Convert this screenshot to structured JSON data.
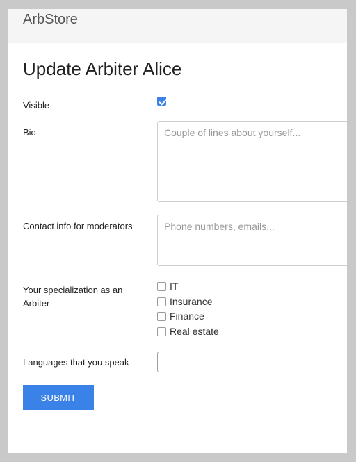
{
  "navbar": {
    "brand": "ArbStore"
  },
  "page": {
    "title": "Update Arbiter Alice"
  },
  "form": {
    "visible": {
      "label": "Visible",
      "checked": true
    },
    "bio": {
      "label": "Bio",
      "placeholder": "Couple of lines about yourself..."
    },
    "contact": {
      "label": "Contact info for moderators",
      "placeholder": "Phone numbers, emails..."
    },
    "specialization": {
      "label": "Your specialization as an Arbiter",
      "options": [
        {
          "label": "IT",
          "checked": false
        },
        {
          "label": "Insurance",
          "checked": false
        },
        {
          "label": "Finance",
          "checked": false
        },
        {
          "label": "Real estate",
          "checked": false
        }
      ]
    },
    "languages": {
      "label": "Languages that you speak",
      "value": ""
    },
    "submit_label": "SUBMIT"
  },
  "colors": {
    "accent": "#3b82e8",
    "navbar_bg": "#f5f5f5",
    "backdrop": "#c9c9c9"
  }
}
